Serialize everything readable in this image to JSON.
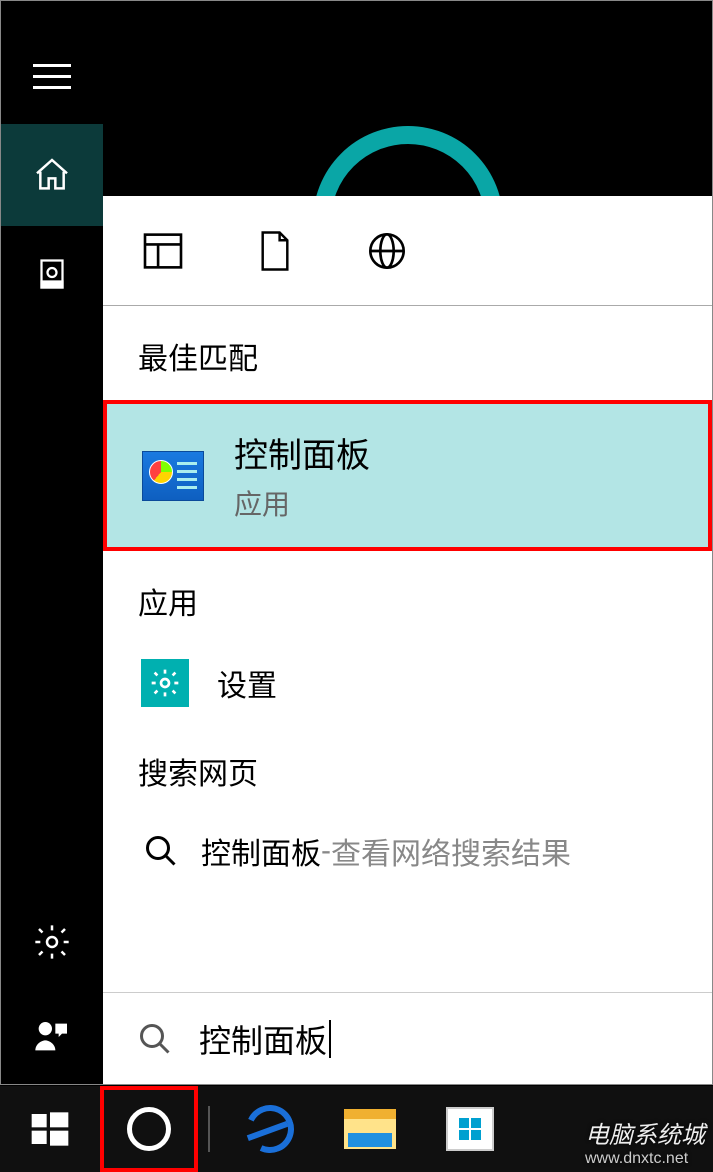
{
  "sidebar": {
    "menu_label": "menu",
    "home_label": "home",
    "notebook_label": "notebook",
    "settings_label": "settings",
    "feedback_label": "feedback"
  },
  "filters": {
    "apps_label": "apps-filter",
    "documents_label": "documents-filter",
    "web_label": "web-filter"
  },
  "sections": {
    "best_match": "最佳匹配",
    "apps": "应用",
    "web": "搜索网页"
  },
  "best_match_item": {
    "title": "控制面板",
    "subtitle": "应用"
  },
  "app_item": {
    "label": "设置"
  },
  "web_item": {
    "term": "控制面板",
    "separator": " - ",
    "hint": "查看网络搜索结果"
  },
  "search": {
    "value": "控制面板"
  },
  "watermark": {
    "brand": "电脑系统城",
    "url": "www.dnxtc.net"
  }
}
